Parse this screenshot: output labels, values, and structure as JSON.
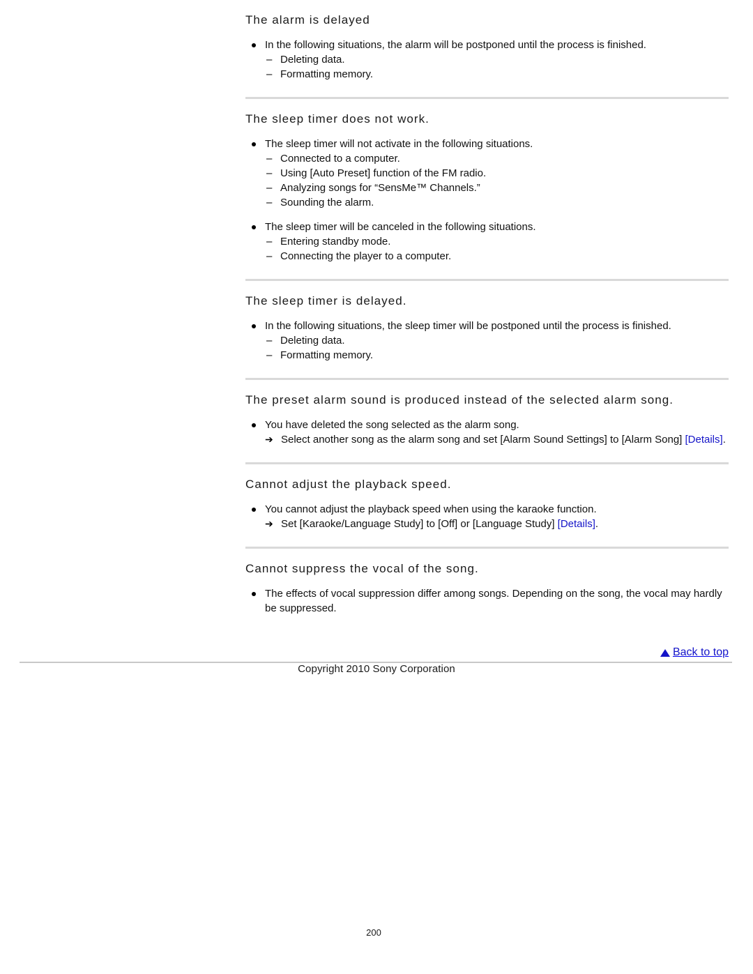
{
  "document": {
    "page_number": "200",
    "copyright": "Copyright 2010 Sony Corporation",
    "back_to_top": "Back to top",
    "link_color": "#1414c8",
    "divider_color": "#d9d9d9"
  },
  "sections": [
    {
      "heading": "The alarm is delayed",
      "has_divider_above": false,
      "groups": [
        {
          "bullet": "In the following situations, the alarm will be postponed until the process is finished.",
          "subs": [
            "Deleting data.",
            "Formatting memory."
          ]
        }
      ]
    },
    {
      "heading": "The sleep timer does not work.",
      "has_divider_above": true,
      "groups": [
        {
          "bullet": "The sleep timer will not activate in the following situations.",
          "subs": [
            "Connected to a computer.",
            "Using [Auto Preset] function of the FM radio.",
            "Analyzing songs for “SensMe™ Channels.”",
            "Sounding the alarm."
          ]
        },
        {
          "bullet": "The sleep timer will be canceled in the following situations.",
          "subs": [
            "Entering standby mode.",
            "Connecting the player to a computer."
          ]
        }
      ]
    },
    {
      "heading": "The sleep timer is delayed.",
      "has_divider_above": true,
      "groups": [
        {
          "bullet": "In the following situations, the sleep timer will be postponed until the process is finished.",
          "subs": [
            "Deleting data.",
            "Formatting memory."
          ]
        }
      ]
    },
    {
      "heading": "The preset alarm sound is produced instead of the selected alarm song.",
      "has_divider_above": true,
      "groups": [
        {
          "bullet": "You have deleted the song selected as the alarm song.",
          "arrow_pre": "Select another song as the alarm song and set [Alarm Sound Settings] to [Alarm Song] ",
          "arrow_link": "[Details]",
          "arrow_post": "."
        }
      ]
    },
    {
      "heading": "Cannot adjust the playback speed.",
      "has_divider_above": true,
      "groups": [
        {
          "bullet": "You cannot adjust the playback speed when using the karaoke function.",
          "arrow_pre": "Set [Karaoke/Language Study] to [Off] or [Language Study] ",
          "arrow_link": "[Details]",
          "arrow_post": "."
        }
      ]
    },
    {
      "heading": "Cannot suppress the vocal of the song.",
      "has_divider_above": true,
      "groups": [
        {
          "bullet": "The effects of vocal suppression differ among songs. Depending on the song, the vocal may hardly be suppressed."
        }
      ]
    }
  ]
}
